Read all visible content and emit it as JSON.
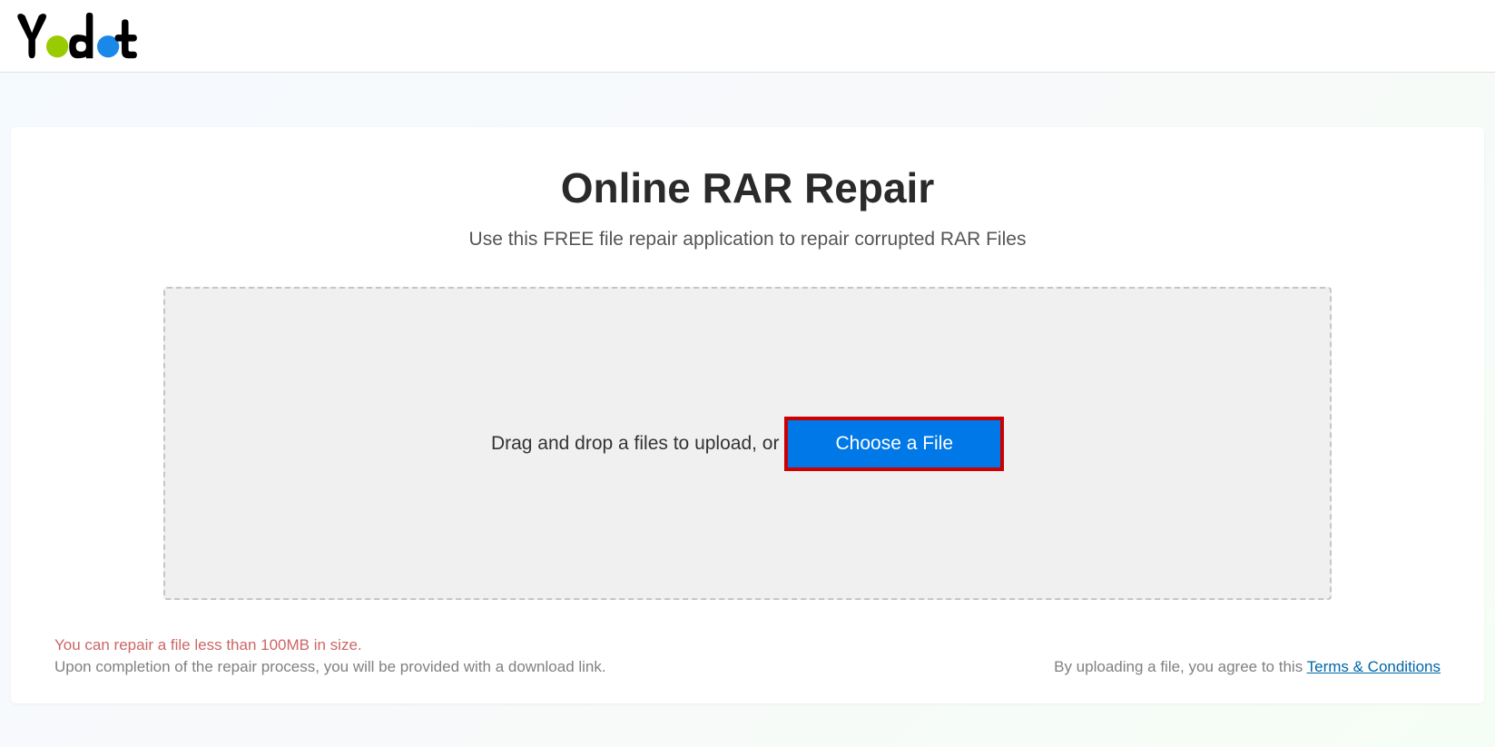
{
  "header": {
    "brand": "Yodot"
  },
  "main": {
    "title": "Online RAR Repair",
    "subtitle": "Use this FREE file repair application to repair corrupted RAR Files",
    "dropzone": {
      "text": "Drag and drop a files to upload, or",
      "button_label": "Choose a File"
    }
  },
  "footer": {
    "warning": "You can repair a file less than 100MB in size.",
    "note": "Upon completion of the repair process, you will be provided with a download link.",
    "agree_prefix": "By uploading a file, you agree to this ",
    "terms_label": "Terms & Conditions"
  }
}
